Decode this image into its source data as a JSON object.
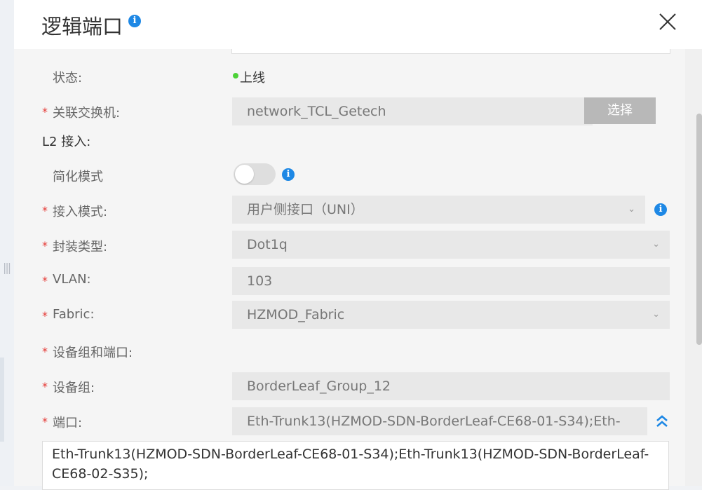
{
  "dialog": {
    "title": "逻辑端口",
    "close": "close"
  },
  "status": {
    "label": "状态:",
    "value": "上线",
    "color": "#4cd137"
  },
  "switch": {
    "label": "关联交换机:",
    "value": "network_TCL_Getech",
    "button": "选择"
  },
  "l2": {
    "label": "L2 接入:"
  },
  "simple_mode": {
    "label": "简化模式",
    "enabled": false
  },
  "access_mode": {
    "label": "接入模式:",
    "value": "用户侧接口（UNI）"
  },
  "encap": {
    "label": "封装类型:",
    "value": "Dot1q"
  },
  "vlan": {
    "label": "VLAN:",
    "value": "103"
  },
  "fabric": {
    "label": "Fabric:",
    "value": "HZMOD_Fabric"
  },
  "device_ports": {
    "label": "设备组和端口:"
  },
  "device_group": {
    "label": "设备组:",
    "value": "BorderLeaf_Group_12"
  },
  "port": {
    "label": "端口:",
    "value": "Eth-Trunk13(HZMOD-SDN-BorderLeaf-CE68-01-S34);Eth-",
    "expanded": "Eth-Trunk13(HZMOD-SDN-BorderLeaf-CE68-01-S34);Eth-Trunk13(HZMOD-SDN-BorderLeaf-CE68-02-S35);"
  },
  "required_mark": "*",
  "info_glyph": "i",
  "colors": {
    "required": "#e53935",
    "info": "#1e88e5",
    "field_bg": "#e8e8e8"
  }
}
